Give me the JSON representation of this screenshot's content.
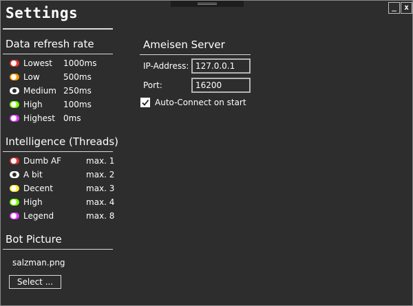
{
  "window": {
    "title": "Settings",
    "minimize_label": "_",
    "close_label": "x"
  },
  "refresh": {
    "heading": "Data refresh rate",
    "options": [
      {
        "label": "Lowest",
        "value": "1000ms",
        "color": "#e53935",
        "selected": false
      },
      {
        "label": "Low",
        "value": "500ms",
        "color": "#ff9800",
        "selected": false
      },
      {
        "label": "Medium",
        "value": "250ms",
        "color": "#ffeb3b",
        "selected": true
      },
      {
        "label": "High",
        "value": "100ms",
        "color": "#76ff03",
        "selected": false
      },
      {
        "label": "Highest",
        "value": "0ms",
        "color": "#e040fb",
        "selected": false
      }
    ]
  },
  "threads": {
    "heading": "Intelligence (Threads)",
    "options": [
      {
        "label": "Dumb AF",
        "value": "max. 1",
        "color": "#e53935",
        "selected": false
      },
      {
        "label": "A bit",
        "value": "max. 2",
        "color": "#ff9800",
        "selected": true
      },
      {
        "label": "Decent",
        "value": "max. 3",
        "color": "#ffeb3b",
        "selected": false
      },
      {
        "label": "High",
        "value": "max. 4",
        "color": "#76ff03",
        "selected": false
      },
      {
        "label": "Legend",
        "value": "max. 8",
        "color": "#e040fb",
        "selected": false
      }
    ]
  },
  "picture": {
    "heading": "Bot Picture",
    "filename": "salzman.png",
    "select_label": "Select ..."
  },
  "server": {
    "heading": "Ameisen Server",
    "ip_label": "IP-Address:",
    "ip_value": "127.0.0.1",
    "port_label": "Port:",
    "port_value": "16200",
    "autoconnect_label": "Auto-Connect on start",
    "autoconnect_checked": true
  }
}
